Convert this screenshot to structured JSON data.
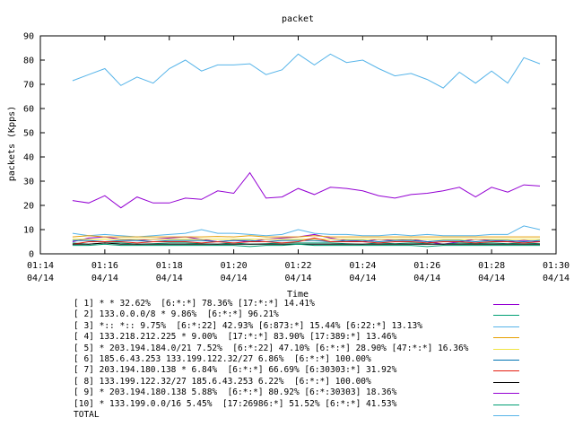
{
  "chart_data": {
    "type": "line",
    "title": "packet",
    "xlabel": "Time",
    "ylabel": "packets (Kpps)",
    "ylim": [
      0,
      90
    ],
    "yticks": [
      0,
      10,
      20,
      30,
      40,
      50,
      60,
      70,
      80,
      90
    ],
    "xlim": [
      "01:14",
      "01:30"
    ],
    "xticks": [
      {
        "time": "01:14",
        "date": "04/14"
      },
      {
        "time": "01:16",
        "date": "04/14"
      },
      {
        "time": "01:18",
        "date": "04/14"
      },
      {
        "time": "01:20",
        "date": "04/14"
      },
      {
        "time": "01:22",
        "date": "04/14"
      },
      {
        "time": "01:24",
        "date": "04/14"
      },
      {
        "time": "01:26",
        "date": "04/14"
      },
      {
        "time": "01:28",
        "date": "04/14"
      },
      {
        "time": "01:30",
        "date": "04/14"
      }
    ],
    "grid": false,
    "legend_placement": "bottom",
    "x": [
      "01:15",
      "01:15:30",
      "01:16",
      "01:16:30",
      "01:17",
      "01:17:30",
      "01:18",
      "01:18:30",
      "01:19",
      "01:19:30",
      "01:20",
      "01:20:30",
      "01:21",
      "01:21:30",
      "01:22",
      "01:22:30",
      "01:23",
      "01:23:30",
      "01:24",
      "01:24:30",
      "01:25",
      "01:25:30",
      "01:26",
      "01:26:30",
      "01:27",
      "01:27:30",
      "01:28",
      "01:28:30",
      "01:29",
      "01:29:30"
    ],
    "series": [
      {
        "name": "[ 1] * * 32.62%  [6:*:*] 78.36% [17:*:*] 14.41%",
        "color": "#9400d3",
        "values": [
          5,
          6.5,
          7,
          6,
          5.5,
          6,
          6.5,
          7,
          6,
          5,
          5.5,
          5,
          6,
          6.5,
          7,
          8,
          6.5,
          5.5,
          5,
          6,
          5.5,
          6,
          5,
          4,
          5,
          6,
          5.5,
          5,
          5.5,
          5
        ]
      },
      {
        "name": "[ 2] 133.0.0.0/8 * 9.86%  [6:*:*] 96.21%",
        "color": "#009e73",
        "values": [
          4.5,
          4,
          4.5,
          4.5,
          4,
          4.2,
          4.5,
          4.5,
          4.2,
          4,
          4.5,
          4,
          4.2,
          4.5,
          4.5,
          4.5,
          4.5,
          4.2,
          4,
          4.5,
          4.2,
          4.5,
          4.2,
          4,
          4.5,
          4.2,
          4.5,
          4.2,
          4.5,
          4.2
        ]
      },
      {
        "name": "[ 3] *:: *:: 9.75%  [6:*:22] 42.93% [6:873:*] 15.44% [6:22:*] 13.13%",
        "color": "#56b4e9",
        "values": [
          8.5,
          7.5,
          8,
          7.5,
          7,
          7.5,
          8,
          8.5,
          10,
          8.5,
          8.5,
          8,
          7.5,
          8,
          10,
          8.5,
          8,
          8,
          7.5,
          7.5,
          8,
          7.5,
          8,
          7.5,
          7.5,
          7.5,
          8,
          8,
          11.5,
          10
        ]
      },
      {
        "name": "[ 4] 133.218.212.225 * 9.00%  [17:*:*] 83.90% [17:389:*] 13.46%",
        "color": "#e69f00",
        "values": [
          7,
          7.5,
          7,
          7,
          7,
          7,
          7,
          7,
          7,
          7.2,
          7,
          7.5,
          7,
          7,
          7,
          7.5,
          7,
          7,
          7,
          7,
          7,
          7,
          7,
          7,
          7,
          7,
          7,
          7,
          7,
          7
        ]
      },
      {
        "name": "[ 5] * 203.194.184.0/21 7.52%  [6:*:22] 47.10% [6:*:*] 28.90% [47:*:*] 16.36%",
        "color": "#f0e442",
        "values": [
          6,
          6,
          6,
          6,
          6,
          6,
          6,
          6,
          6,
          6,
          6,
          6,
          6,
          6,
          6,
          6,
          6,
          6,
          6,
          6,
          6,
          6,
          6,
          6,
          6,
          6,
          6,
          6,
          6,
          6
        ]
      },
      {
        "name": "[ 6] 185.6.43.253 133.199.122.32/27 6.86%  [6:*:*] 100.00%",
        "color": "#0072b2",
        "values": [
          5.5,
          5.5,
          5,
          5.5,
          5.5,
          5,
          5.5,
          5.5,
          5.5,
          5,
          5.5,
          5.5,
          5,
          5.5,
          5.5,
          5.5,
          5,
          5.5,
          5.5,
          5,
          5.5,
          5.5,
          5,
          5.5,
          5.5,
          5,
          5.5,
          5.5,
          5,
          5.5
        ]
      },
      {
        "name": "[ 7] 203.194.180.138 * 6.84%  [6:*:*] 66.69% [6:30303:*] 31.92%",
        "color": "#e51e10",
        "values": [
          4,
          5,
          5,
          5,
          4.5,
          5,
          5,
          5,
          4.5,
          5,
          4.5,
          5,
          5,
          4.5,
          5,
          6.5,
          5,
          5,
          5,
          4.5,
          5,
          5,
          4.5,
          5,
          5,
          4.5,
          5,
          5,
          4.5,
          5
        ]
      },
      {
        "name": "[ 8] 133.199.122.32/27 185.6.43.253 6.22%  [6:*:*] 100.00%",
        "color": "#000000",
        "values": [
          4,
          4,
          4.5,
          4,
          4,
          4,
          4,
          4,
          4,
          4,
          4,
          4,
          4,
          4,
          4,
          4,
          4,
          4,
          4,
          4,
          4,
          4,
          4,
          4,
          4,
          4,
          4,
          4,
          4,
          4
        ]
      },
      {
        "name": "[ 9] * 203.194.180.138 5.88%  [6:*:*] 80.92% [6:*:30303] 18.36%",
        "color": "#9400d3",
        "values": [
          22,
          21,
          24,
          19,
          23.5,
          21,
          21,
          23,
          22.5,
          26,
          25,
          33.5,
          23,
          23.5,
          27,
          24.5,
          27.5,
          27,
          26,
          24,
          23,
          24.5,
          25,
          26,
          27.5,
          23.5,
          27.5,
          25.5,
          28.5,
          28
        ]
      },
      {
        "name": "[10] * 133.199.0.0/16 5.45%  [17:26986:*] 51.52% [6:*:*] 41.53%",
        "color": "#009e73",
        "values": [
          3.5,
          3.5,
          4,
          3.5,
          3.5,
          3.5,
          3.5,
          3.5,
          3.5,
          3.5,
          3.5,
          3,
          3.5,
          3.5,
          4,
          3.5,
          3.5,
          3.5,
          3.5,
          3.5,
          3.5,
          3.5,
          3,
          3.5,
          3.5,
          3.5,
          3.5,
          3.5,
          3.5,
          3.5
        ]
      },
      {
        "name": "TOTAL",
        "color": "#56b4e9",
        "values": [
          71.5,
          74,
          76.5,
          69.5,
          73,
          70.5,
          76.5,
          80,
          75.5,
          78,
          78,
          78.5,
          74,
          76,
          82.5,
          78,
          82.5,
          79,
          80,
          76.5,
          73.5,
          74.5,
          72,
          68.5,
          75,
          70.5,
          75.5,
          70.5,
          81,
          78.5
        ]
      }
    ]
  }
}
